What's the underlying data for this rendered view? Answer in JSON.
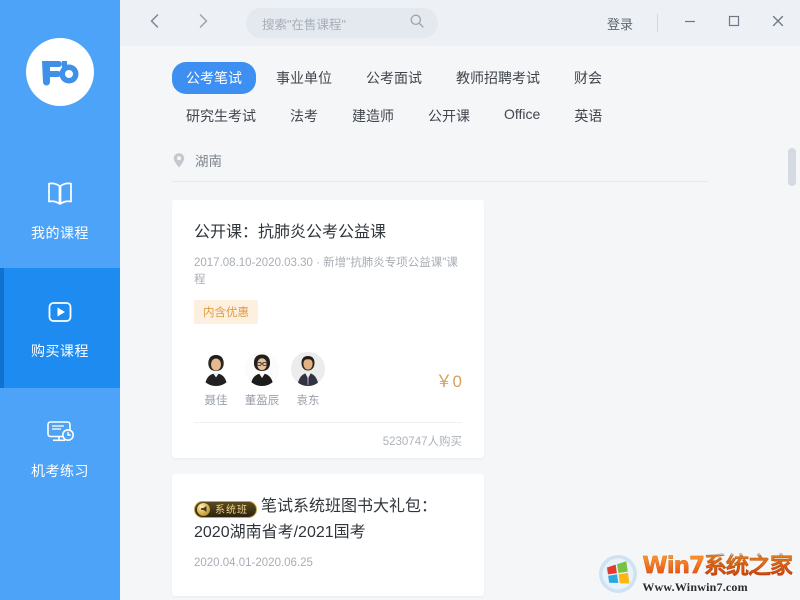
{
  "app": {
    "name": "fenbi-course-app",
    "brand_logo_text": "Fb",
    "accent_color": "#4da3f7",
    "sidebar_active_color": "#1e8bf0",
    "tab_active_color": "#3d8ff2",
    "price_color": "#d8a05c",
    "promo_tag_color": "#e09a42"
  },
  "sidebar": {
    "items": [
      {
        "label": "我的课程",
        "icon": "book-icon",
        "active": false
      },
      {
        "label": "购买课程",
        "icon": "play-video-icon",
        "active": true
      },
      {
        "label": "机考练习",
        "icon": "monitor-clock-icon",
        "active": false
      }
    ]
  },
  "titlebar": {
    "back_icon": "chevron-left-icon",
    "forward_icon": "chevron-right-icon",
    "search_placeholder": "搜索\"在售课程\"",
    "search_value": "",
    "search_icon": "search-icon",
    "login_label": "登录",
    "minimize_icon": "minimize-icon",
    "maximize_icon": "maximize-icon",
    "close_icon": "close-icon"
  },
  "filters": {
    "tabs": [
      {
        "label": "公考笔试",
        "active": true
      },
      {
        "label": "事业单位",
        "active": false
      },
      {
        "label": "公考面试",
        "active": false
      },
      {
        "label": "教师招聘考试",
        "active": false
      },
      {
        "label": "财会",
        "active": false
      },
      {
        "label": "研究生考试",
        "active": false
      },
      {
        "label": "法考",
        "active": false
      },
      {
        "label": "建造师",
        "active": false
      },
      {
        "label": "公开课",
        "active": false
      },
      {
        "label": "Office",
        "active": false
      },
      {
        "label": "英语",
        "active": false
      }
    ],
    "location": {
      "icon": "location-pin-icon",
      "value": "湖南"
    }
  },
  "courses": [
    {
      "badge": "",
      "title": "公开课：抗肺炎公考公益课",
      "date_range": "2017.08.10-2020.03.30",
      "subtitle": "· 新增\"抗肺炎专项公益课\"课程",
      "promo_tag": "内含优惠",
      "teachers": [
        {
          "name": "聂佳"
        },
        {
          "name": "董盈辰"
        },
        {
          "name": "袁东"
        }
      ],
      "price": "￥0",
      "purchase_count": "5230747人购买"
    },
    {
      "badge": "系统班",
      "title": "笔试系统班图书大礼包：2020湖南省考/2021国考",
      "date_range": "2020.04.01-2020.06.25",
      "subtitle": "",
      "promo_tag": "",
      "teachers": [],
      "price": "",
      "purchase_count": ""
    }
  ],
  "scrollbar": {
    "name": "vertical-scrollbar",
    "thumb_position_pct": 18
  },
  "watermark": {
    "main": "Win7系统之家",
    "sub": "Www.Winwin7.com"
  }
}
